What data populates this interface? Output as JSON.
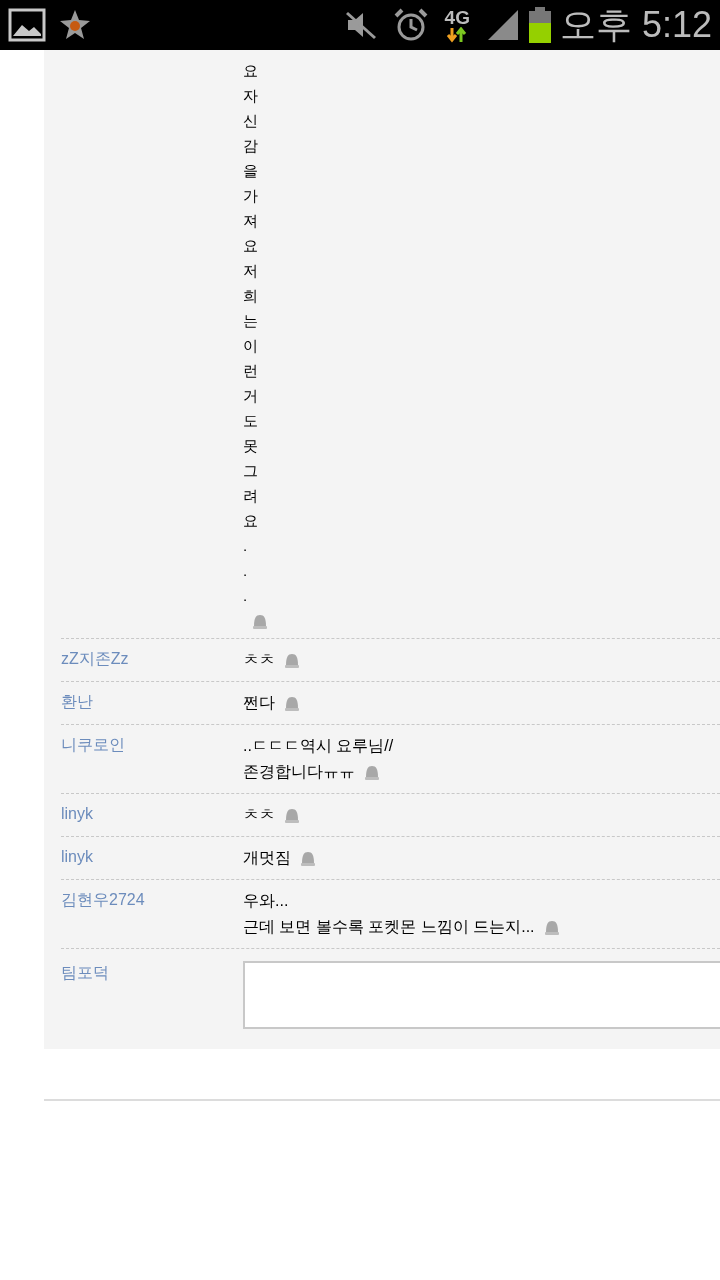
{
  "status_bar": {
    "network": "4G",
    "time": "오후 5:12"
  },
  "comments": [
    {
      "kind": "column",
      "text": "요자신감을가져요저희는이런거도못그려요..."
    },
    {
      "kind": "line",
      "author": "zZ지존Zz",
      "text": "ㅊㅊ"
    },
    {
      "kind": "line",
      "author": "환난",
      "text": "쩐다"
    },
    {
      "kind": "line",
      "author": "니쿠로인",
      "text": "..ㄷㄷㄷ역시 요루님//\n존경합니다ㅠㅠ"
    },
    {
      "kind": "line",
      "author": "linyk",
      "text": "ㅊㅊ"
    },
    {
      "kind": "line",
      "author": "linyk",
      "text": "개멋짐"
    },
    {
      "kind": "line",
      "author": "김현우2724",
      "text": "우와...\n근데 보면 볼수록 포켓몬 느낌이 드는지..."
    }
  ],
  "reply": {
    "author": "팀포덕"
  }
}
